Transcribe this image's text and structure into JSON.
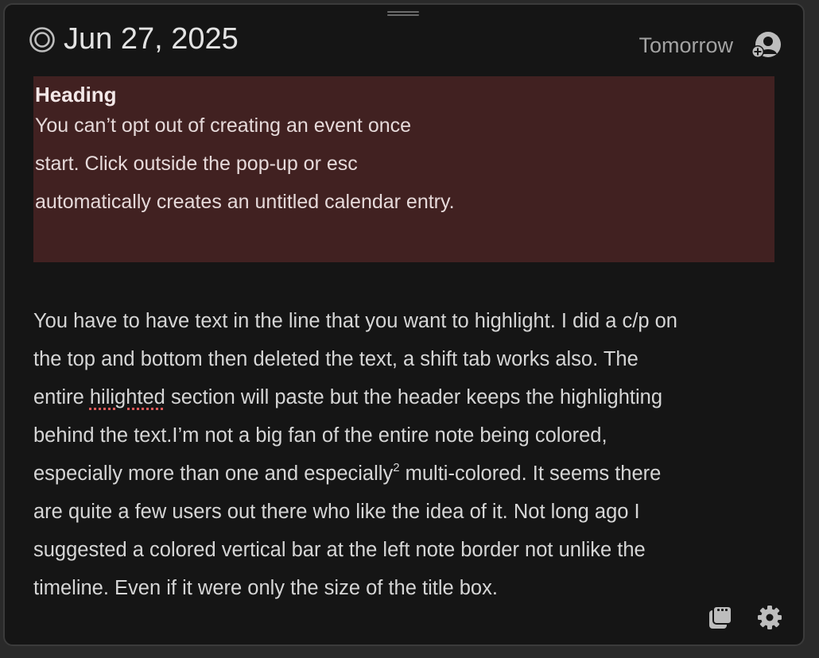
{
  "header": {
    "date": "Jun 27, 2025",
    "tomorrow_label": "Tomorrow"
  },
  "highlight": {
    "heading": "Heading",
    "lines": [
      "You can’t opt out of creating an event once",
      "start. Click outside the pop-up or esc",
      "automatically creates an untitled calendar entry."
    ],
    "background_color": "#412121"
  },
  "body": {
    "line1": "You have to have text in the line that you want to highlight. I did a c/p on",
    "line2": "the top and bottom then deleted the text, a shift tab works also.  The",
    "line3_pre": "entire ",
    "line3_misspelled": "hilighted",
    "line3_post": " section will paste but the header keeps the highlighting",
    "line4": "behind the text.I’m not a big fan of the entire note being colored,",
    "line5_pre": "especially more than one and especially",
    "line5_sup": "2",
    "line5_post": " multi-colored.  It seems  there",
    "line6": "are quite a few users out there who like the idea of it.  Not long ago I",
    "line7": "suggested a colored vertical bar at the left note border not unlike the",
    "line8": "timeline. Even if it were only the size of the title box."
  },
  "icons": {
    "date": "target-icon",
    "contact": "add-contact-icon",
    "copy": "copy-icon",
    "settings": "gear-icon"
  }
}
